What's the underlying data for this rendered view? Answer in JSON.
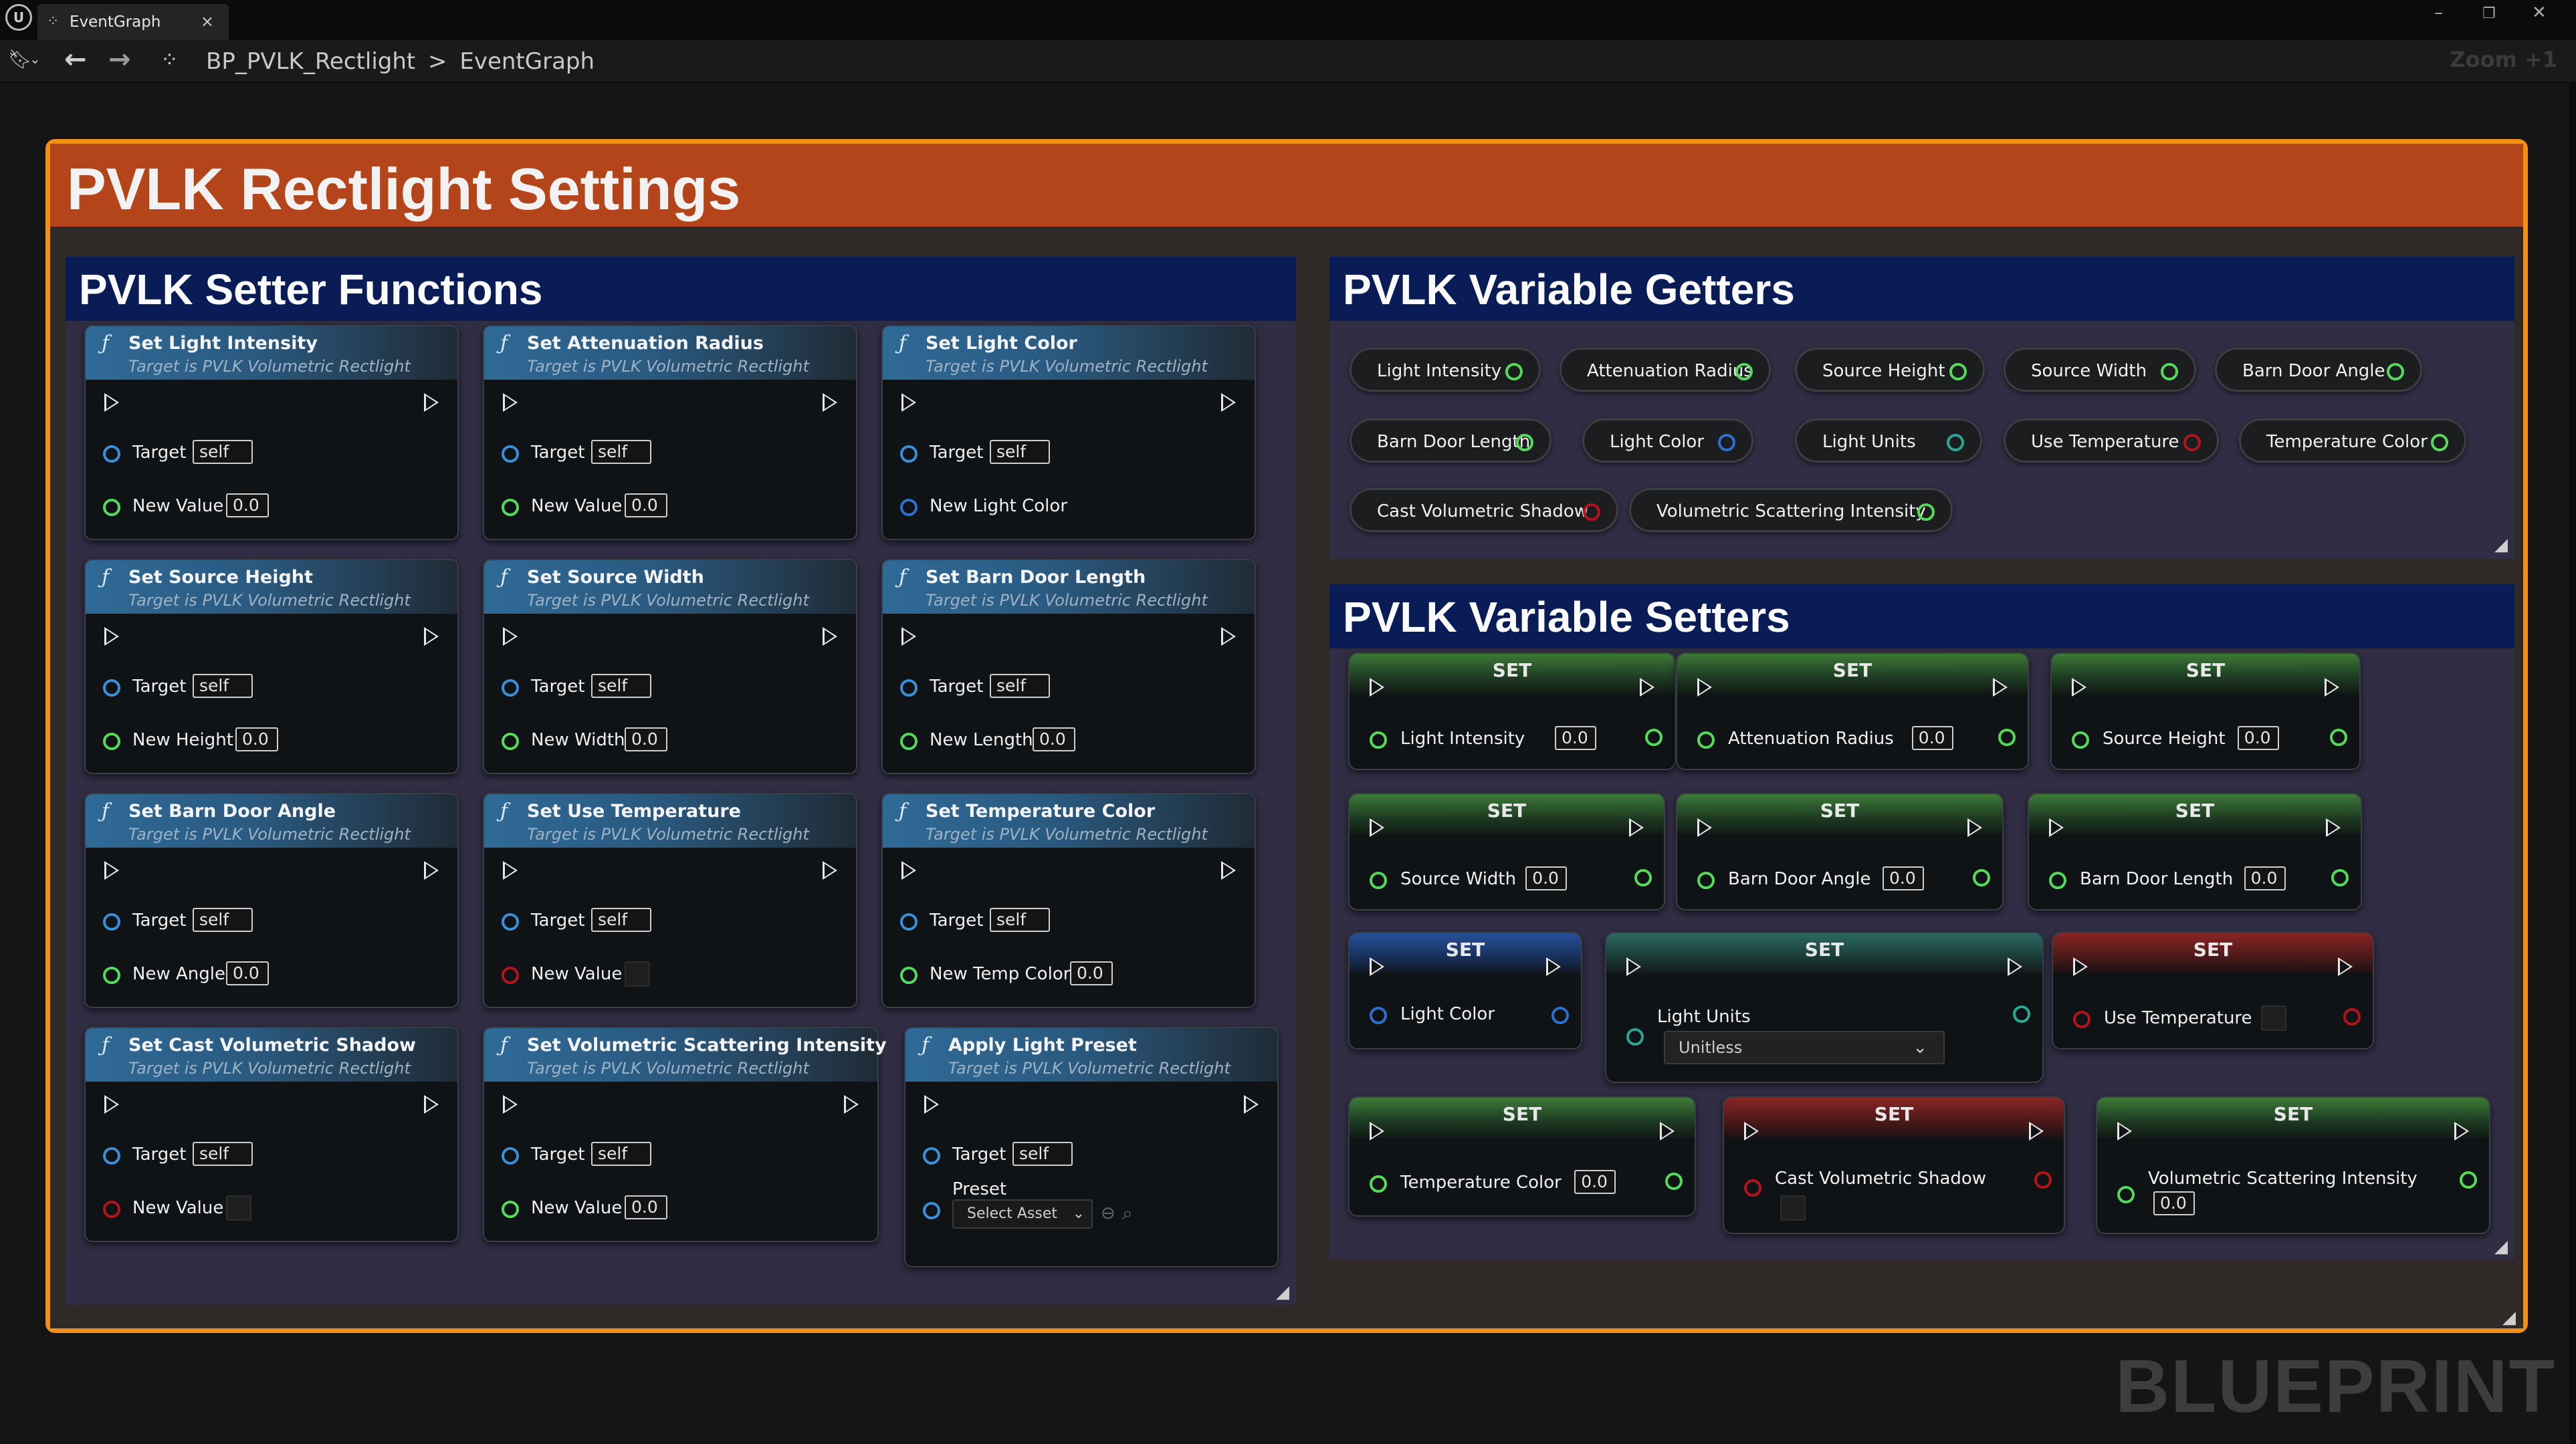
{
  "tab": {
    "title": "EventGraph"
  },
  "breadcrumb": {
    "blueprint": "BP_PVLK_Rectlight",
    "separator": ">",
    "graph": "EventGraph"
  },
  "zoom": "Zoom +1",
  "watermark": "BLUEPRINT",
  "outer_comment": "PVLK Rectlight Settings",
  "setter_functions_title": "PVLK Setter Functions",
  "getters_title": "PVLK Variable Getters",
  "setters_title": "PVLK Variable Setters",
  "functions": [
    {
      "name": "Set Light Intensity",
      "sub": "Target is PVLK Volumetric Rectlight",
      "target_label": "Target",
      "target_val": "self",
      "param": "New Value",
      "param_val": "0.0",
      "param_type": "float"
    },
    {
      "name": "Set Attenuation Radius",
      "sub": "Target is PVLK Volumetric Rectlight",
      "target_label": "Target",
      "target_val": "self",
      "param": "New Value",
      "param_val": "0.0",
      "param_type": "float"
    },
    {
      "name": "Set Light Color",
      "sub": "Target is PVLK Volumetric Rectlight",
      "target_label": "Target",
      "target_val": "self",
      "param": "New Light Color",
      "param_val": "",
      "param_type": "color"
    },
    {
      "name": "Set Source Height",
      "sub": "Target is PVLK Volumetric Rectlight",
      "target_label": "Target",
      "target_val": "self",
      "param": "New Height",
      "param_val": "0.0",
      "param_type": "float"
    },
    {
      "name": "Set Source Width",
      "sub": "Target is PVLK Volumetric Rectlight",
      "target_label": "Target",
      "target_val": "self",
      "param": "New Width",
      "param_val": "0.0",
      "param_type": "float"
    },
    {
      "name": "Set Barn Door Length",
      "sub": "Target is PVLK Volumetric Rectlight",
      "target_label": "Target",
      "target_val": "self",
      "param": "New Length",
      "param_val": "0.0",
      "param_type": "float"
    },
    {
      "name": "Set Barn Door Angle",
      "sub": "Target is PVLK Volumetric Rectlight",
      "target_label": "Target",
      "target_val": "self",
      "param": "New Angle",
      "param_val": "0.0",
      "param_type": "float"
    },
    {
      "name": "Set Use Temperature",
      "sub": "Target is PVLK Volumetric Rectlight",
      "target_label": "Target",
      "target_val": "self",
      "param": "New Value",
      "param_val": "",
      "param_type": "bool"
    },
    {
      "name": "Set Temperature Color",
      "sub": "Target is PVLK Volumetric Rectlight",
      "target_label": "Target",
      "target_val": "self",
      "param": "New Temp Color",
      "param_val": "0.0",
      "param_type": "float"
    },
    {
      "name": "Set Cast Volumetric Shadow",
      "sub": "Target is PVLK Volumetric Rectlight",
      "target_label": "Target",
      "target_val": "self",
      "param": "New Value",
      "param_val": "",
      "param_type": "bool"
    },
    {
      "name": "Set Volumetric Scattering Intensity",
      "sub": "Target is PVLK Volumetric Rectlight",
      "target_label": "Target",
      "target_val": "self",
      "param": "New Value",
      "param_val": "0.0",
      "param_type": "float"
    },
    {
      "name": "Apply Light Preset",
      "sub": "Target is PVLK Volumetric Rectlight",
      "target_label": "Target",
      "target_val": "self",
      "param": "Preset",
      "param_val": "Select Asset",
      "param_type": "asset"
    }
  ],
  "getters": [
    {
      "label": "Light Intensity",
      "type": "float"
    },
    {
      "label": "Attenuation Radius",
      "type": "float"
    },
    {
      "label": "Source Height",
      "type": "float"
    },
    {
      "label": "Source Width",
      "type": "float"
    },
    {
      "label": "Barn Door Angle",
      "type": "float"
    },
    {
      "label": "Barn Door Length",
      "type": "float"
    },
    {
      "label": "Light Color",
      "type": "color"
    },
    {
      "label": "Light Units",
      "type": "enum"
    },
    {
      "label": "Use Temperature",
      "type": "bool"
    },
    {
      "label": "Temperature Color",
      "type": "float"
    },
    {
      "label": "Cast Volumetric Shadow",
      "type": "bool"
    },
    {
      "label": "Volumetric Scattering Intensity",
      "type": "float"
    }
  ],
  "set_nodes": [
    {
      "title": "SET",
      "label": "Light Intensity",
      "value": "0.0",
      "type": "float"
    },
    {
      "title": "SET",
      "label": "Attenuation Radius",
      "value": "0.0",
      "type": "float"
    },
    {
      "title": "SET",
      "label": "Source Height",
      "value": "0.0",
      "type": "float"
    },
    {
      "title": "SET",
      "label": "Source Width",
      "value": "0.0",
      "type": "float"
    },
    {
      "title": "SET",
      "label": "Barn Door Angle",
      "value": "0.0",
      "type": "float"
    },
    {
      "title": "SET",
      "label": "Barn Door Length",
      "value": "0.0",
      "type": "float"
    },
    {
      "title": "SET",
      "label": "Light Color",
      "value": "",
      "type": "color"
    },
    {
      "title": "SET",
      "label": "Light Units",
      "value": "Unitless",
      "type": "enum"
    },
    {
      "title": "SET",
      "label": "Use Temperature",
      "value": "",
      "type": "bool"
    },
    {
      "title": "SET",
      "label": "Temperature Color",
      "value": "0.0",
      "type": "float"
    },
    {
      "title": "SET",
      "label": "Cast Volumetric Shadow",
      "value": "",
      "type": "bool"
    },
    {
      "title": "SET",
      "label": "Volumetric Scattering Intensity",
      "value": "0.0",
      "type": "float"
    }
  ],
  "pin_colors": {
    "float": "#55d95a",
    "color": "#2d6fd1",
    "bool": "#b3141b",
    "enum": "#2aa596",
    "object": "#3b8fd9"
  },
  "comment_colors": {
    "outer_border": "#f28f17",
    "outer_header": "#b4451a",
    "group_header": "#0a1c55"
  }
}
